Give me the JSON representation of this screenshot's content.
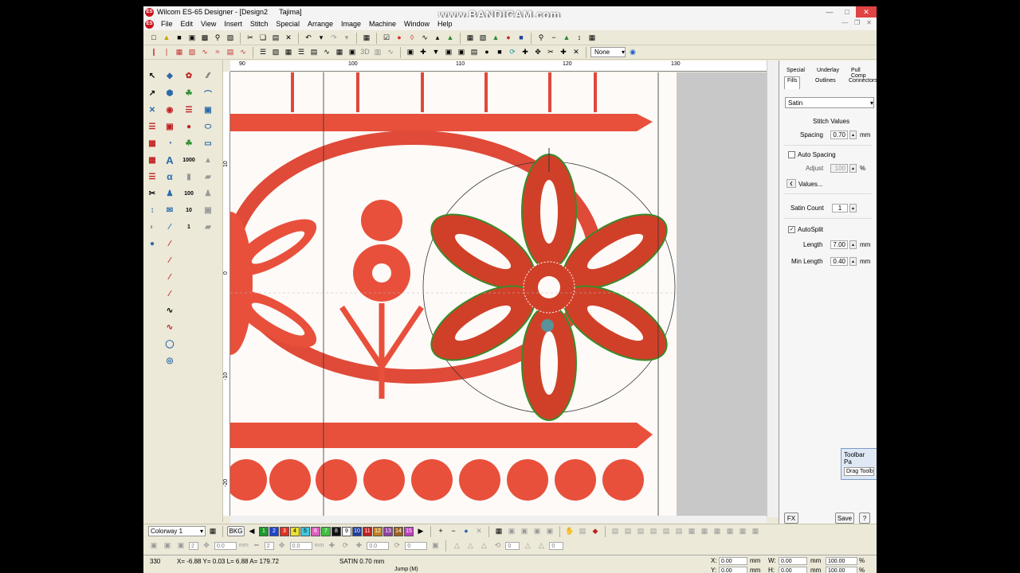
{
  "window": {
    "title": "Wilcom ES-65 Designer - [Design2",
    "subtitle": "Tajima]",
    "watermark": "www.BANDICAM.com"
  },
  "menu": [
    "File",
    "Edit",
    "View",
    "Insert",
    "Stitch",
    "Special",
    "Arrange",
    "Image",
    "Machine",
    "Window",
    "Help"
  ],
  "toolbar2": {
    "select_value": "None"
  },
  "ruler": {
    "top": [
      "90",
      "100",
      "110",
      "120",
      "130"
    ],
    "left": [
      "10",
      "0",
      "-10",
      "-20"
    ]
  },
  "docker": {
    "tabs": {
      "special": "Special",
      "underlay": "Underlay",
      "pull_comp": "Pull Comp",
      "fills": "Fills",
      "outlines": "Outlines",
      "connectors": "Connectors"
    },
    "fill_type": "Satin",
    "stitch_values_heading": "Stitch Values",
    "spacing_label": "Spacing",
    "spacing_value": "0.70",
    "mm": "mm",
    "auto_spacing_label": "Auto Spacing",
    "adjust_label": "Adjust",
    "adjust_value": "100",
    "percent": "%",
    "values_button": "Values...",
    "satin_count_label": "Satin Count",
    "satin_count_value": "1",
    "autosplit_label": "AutoSplit",
    "autosplit_checked": "✓",
    "length_label": "Length",
    "length_value": "7.00",
    "min_length_label": "Min Length",
    "min_length_value": "0.40",
    "toolbar_panel_title": "Toolbar Pa",
    "toolbar_panel_text": "Drag Toolb",
    "fx_button": "FX",
    "save_button": "Save",
    "help_button": "?"
  },
  "colorbar": {
    "colorway": "Colorway 1",
    "bkg": "BKG",
    "swatches": [
      {
        "n": "1",
        "color": "#1a9a2a"
      },
      {
        "n": "2",
        "color": "#2244cc"
      },
      {
        "n": "3",
        "color": "#e03020"
      },
      {
        "n": "4",
        "color": "#e8e030"
      },
      {
        "n": "5",
        "color": "#40c8e0"
      },
      {
        "n": "6",
        "color": "#e060c0"
      },
      {
        "n": "7",
        "color": "#40c040"
      },
      {
        "n": "8",
        "color": "#111111"
      },
      {
        "n": "9",
        "color": "#ffffff"
      },
      {
        "n": "10",
        "color": "#2040a0"
      },
      {
        "n": "11",
        "color": "#c02020"
      },
      {
        "n": "12",
        "color": "#c08020"
      },
      {
        "n": "13",
        "color": "#9040a0"
      },
      {
        "n": "14",
        "color": "#a06020"
      },
      {
        "n": "15",
        "color": "#c040c0"
      }
    ]
  },
  "toolbar_bottom": {
    "v1": "2",
    "v2": "0.0",
    "v3": "2",
    "v4": "0.0",
    "v5": "0.0",
    "v6": "0",
    "v7": "0",
    "v8": "0",
    "unit": "mm"
  },
  "status": {
    "stitch_count": "330",
    "coords": "X= -6.88 Y= 0.03 L= 6.88 A= 179.72",
    "stitch_type": "SATIN  0.70 mm",
    "jump": "Jump (M)",
    "x_label": "X:",
    "x_val": "0.00",
    "y_label": "Y:",
    "y_val": "0.00",
    "w_label": "W:",
    "w_val": "0.00",
    "h_label": "H:",
    "h_val": "0.00",
    "pct1": "100.00",
    "pct2": "100.00",
    "mm": "mm",
    "pct": "%"
  }
}
